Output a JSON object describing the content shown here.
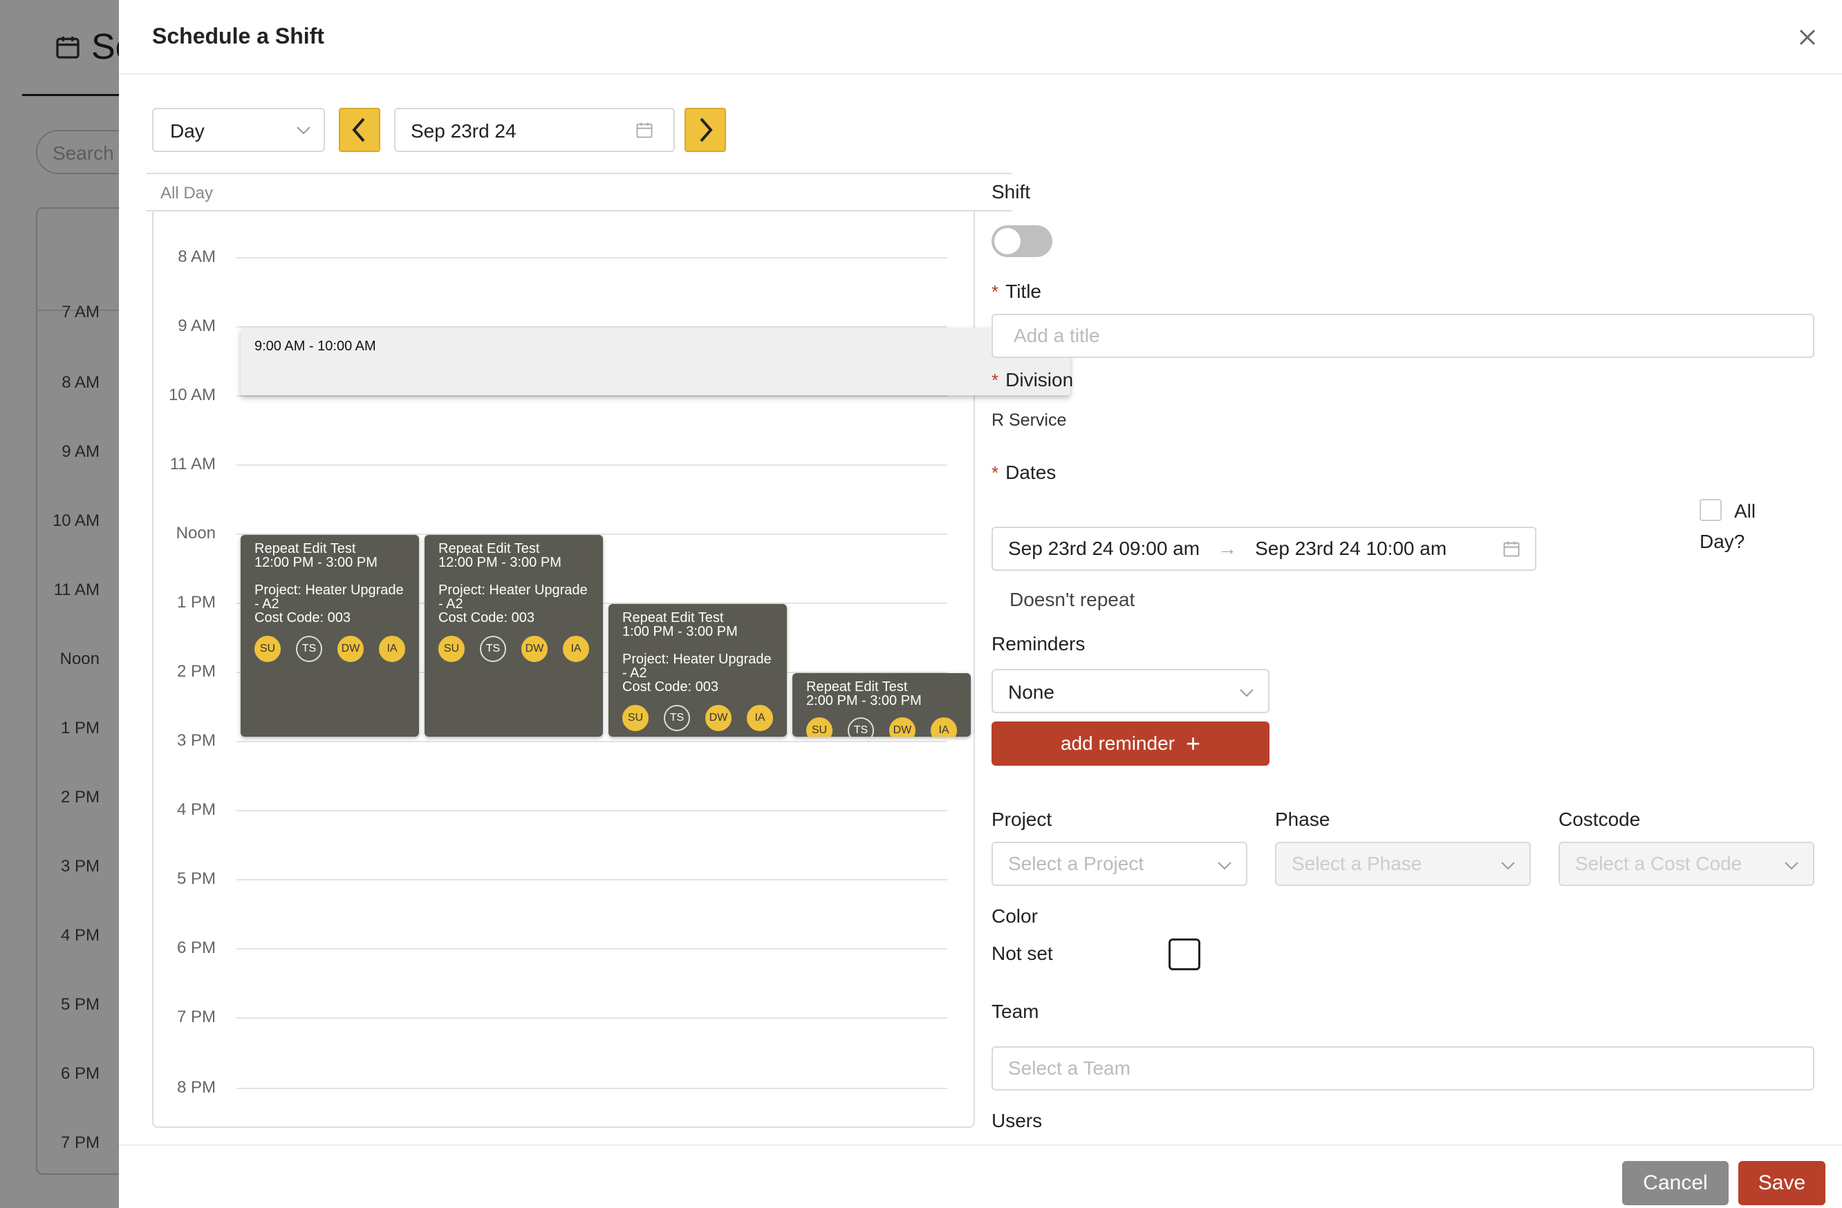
{
  "background": {
    "page_title_fragment": "Sc",
    "search_placeholder": "Search",
    "times": [
      "7 AM",
      "8 AM",
      "9 AM",
      "10 AM",
      "11 AM",
      "Noon",
      "1 PM",
      "2 PM",
      "3 PM",
      "4 PM",
      "5 PM",
      "6 PM",
      "7 PM"
    ]
  },
  "drawer": {
    "title": "Schedule a Shift",
    "view_select": "Day",
    "date_value": "Sep 23rd 24",
    "all_day_label": "All Day",
    "hours": [
      "8 AM",
      "9 AM",
      "10 AM",
      "11 AM",
      "Noon",
      "1 PM",
      "2 PM",
      "3 PM",
      "4 PM",
      "5 PM",
      "6 PM",
      "7 PM",
      "8 PM"
    ],
    "events": {
      "selected_time": "9:00 AM - 10:00 AM",
      "e1": {
        "title": "Repeat Edit Test",
        "time": "12:00 PM - 3:00 PM",
        "project": "Project: Heater Upgrade",
        "project2": "- A2",
        "cost": "Cost Code: 003"
      },
      "e2": {
        "title": "Repeat Edit Test",
        "time": "12:00 PM - 3:00 PM",
        "project": "Project: Heater Upgrade",
        "project2": "- A2",
        "cost": "Cost Code: 003"
      },
      "e3": {
        "title": "Repeat Edit Test",
        "time": "1:00 PM - 3:00 PM",
        "project": "Project: Heater Upgrade",
        "project2": "- A2",
        "cost": "Cost Code: 003"
      },
      "e4": {
        "title": "Repeat Edit Test",
        "time": "2:00 PM - 3:00 PM"
      },
      "avatars": [
        "SU",
        "TS",
        "DW",
        "IA"
      ]
    }
  },
  "form": {
    "shift_label": "Shift",
    "title_label": "Title",
    "title_placeholder": "Add a title",
    "division_label": "Division",
    "division_value": "R Service",
    "dates_label": "Dates",
    "date_start": "Sep 23rd 24 09:00 am",
    "date_arrow": "→",
    "date_end": "Sep 23rd 24 10:00 am",
    "all_day_check_label": "All",
    "all_day_check_label2": "Day?",
    "repeat": "Doesn't repeat",
    "reminders_label": "Reminders",
    "reminder_value": "None",
    "add_reminder": "add reminder",
    "add_reminder_icon": "+",
    "project_label": "Project",
    "project_placeholder": "Select a Project",
    "phase_label": "Phase",
    "phase_placeholder": "Select a Phase",
    "costcode_label": "Costcode",
    "costcode_placeholder": "Select a Cost Code",
    "color_label": "Color",
    "color_value": "Not set",
    "team_label": "Team",
    "team_placeholder": "Select a Team",
    "users_label": "Users",
    "cancel": "Cancel",
    "save": "Save"
  },
  "colors": {
    "accent_yellow": "#f0c23b",
    "brand_red": "#b8402a",
    "event_dark": "#5a5a52"
  }
}
